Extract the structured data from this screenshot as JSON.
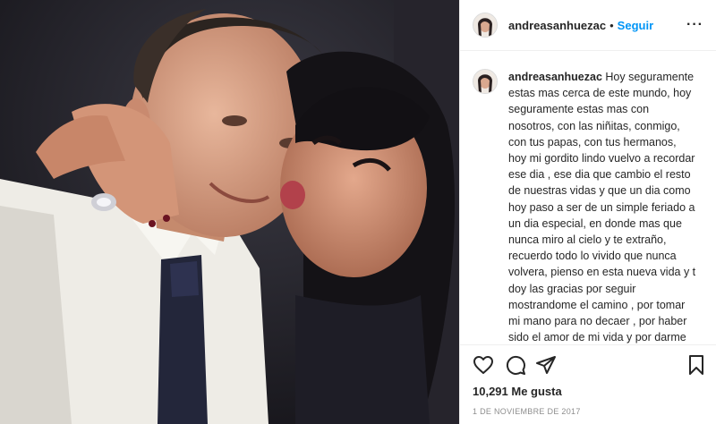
{
  "post": {
    "username": "andreasanhuezac",
    "follow_label": "Seguir",
    "separator": "•",
    "more_label": "···",
    "caption_text": "Hoy seguramente estas mas cerca de este mundo, hoy seguramente estas mas con nosotros, con las niñitas, conmigo, con tus papas, con tus hermanos, hoy mi gordito lindo vuelvo a recordar ese dia , ese dia que cambio el resto de nuestras vidas y que un dia como hoy paso a ser de un simple feriado a un dia especial, en donde mas que nunca miro al cielo y te extraño, recuerdo todo lo vivido que nunca volvera, pienso en esta nueva vida y t doy las gracias por seguir mostrandome el camino , por tomar mi mano para no decaer , por haber sido el amor de mi vida y por darme la oportunidad d una nueva vida, espero me sigas dando la fuerza para continuar....",
    "caption_emoji": "❤️❤️❤️🙏",
    "caption_emoji_tail": "🙏",
    "likes": "10,291 Me gusta",
    "date": "1 DE NOVIEMBRE DE 2017"
  },
  "icons": {
    "like": "heart-icon",
    "comment": "comment-icon",
    "share": "send-icon",
    "save": "bookmark-icon"
  },
  "colors": {
    "link": "#0095f6",
    "text": "#262626",
    "muted": "#8e8e8e",
    "border": "#efefef",
    "heart": "#e0245e"
  }
}
